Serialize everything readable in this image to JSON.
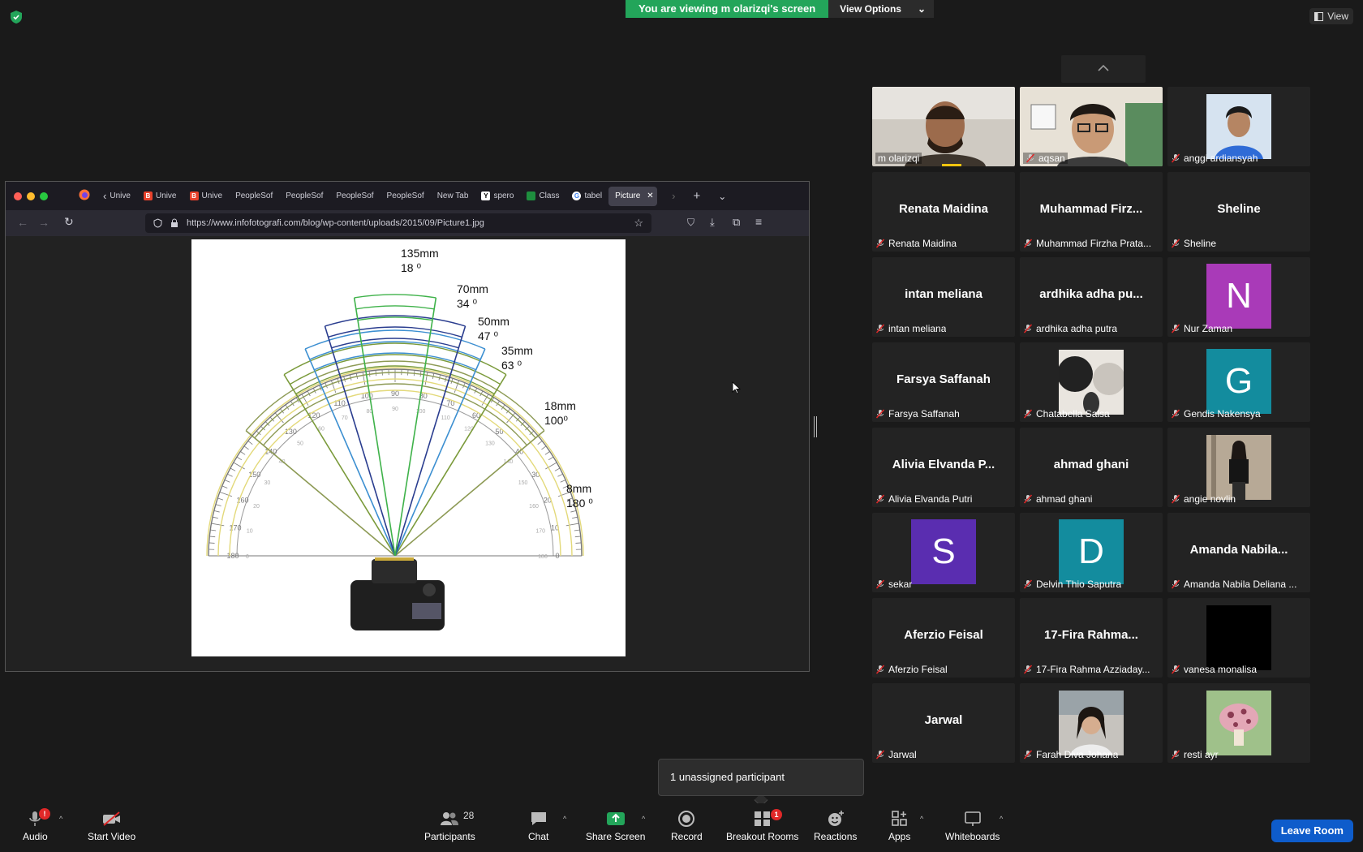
{
  "banner": {
    "viewing": "You are viewing m olarizqi's screen",
    "view_options": "View Options"
  },
  "view_button": "View",
  "browser": {
    "tabs": [
      "Unive",
      "Unive",
      "Unive",
      "PeopleSof",
      "PeopleSof",
      "PeopleSof",
      "PeopleSof",
      "New Tab",
      "spero",
      "Class",
      "tabel",
      "Picture"
    ],
    "url": "https://www.infofotografi.com/blog/wp-content/uploads/2015/09/Picture1.jpg"
  },
  "diagram": {
    "labels": [
      {
        "mm": "135mm",
        "deg": "18 ⁰"
      },
      {
        "mm": "70mm",
        "deg": "34 ⁰"
      },
      {
        "mm": "50mm",
        "deg": "47 ⁰"
      },
      {
        "mm": "35mm",
        "deg": "63 ⁰"
      },
      {
        "mm": "18mm",
        "deg": "100⁰"
      },
      {
        "mm": "8mm",
        "deg": "180 ⁰"
      }
    ],
    "colors": {
      "c135": "#3fb24a",
      "c70": "#2a3d8f",
      "c50": "#3c8fd1",
      "c35": "#7a9a3a",
      "c18": "#8d9a55",
      "c8": "#e3d97a"
    }
  },
  "participants": [
    {
      "name": "m olarizqi",
      "kind": "video",
      "photo": "man-glasses-off"
    },
    {
      "name": "aqsan",
      "kind": "video",
      "photo": "boy-glasses"
    },
    {
      "name": "anggi ardiansyah",
      "kind": "photo",
      "photo": "boy-blue"
    },
    {
      "name": "Renata Maidina",
      "kind": "text",
      "big": "Renata Maidina"
    },
    {
      "name": "Muhammad Firzha Prata...",
      "kind": "text",
      "big": "Muhammad  Firz..."
    },
    {
      "name": "Sheline",
      "kind": "text",
      "big": "Sheline"
    },
    {
      "name": "intan meliana",
      "kind": "text",
      "big": "intan meliana"
    },
    {
      "name": "ardhika adha putra",
      "kind": "text",
      "big": "ardhika  adha  pu..."
    },
    {
      "name": "Nur Zaman",
      "kind": "avatar",
      "letter": "N",
      "color": "#a93ab8"
    },
    {
      "name": "Farsya Saffanah",
      "kind": "text",
      "big": "Farsya Saffanah"
    },
    {
      "name": "Chatabella Salsa",
      "kind": "photo",
      "photo": "circles"
    },
    {
      "name": "Gendis Nakensya",
      "kind": "avatar",
      "letter": "G",
      "color": "#138c9e"
    },
    {
      "name": "Alivia Elvanda Putri",
      "kind": "text",
      "big": "Alivia  Elvanda  P..."
    },
    {
      "name": "ahmad ghani",
      "kind": "text",
      "big": "ahmad ghani"
    },
    {
      "name": "angie novlin",
      "kind": "photo",
      "photo": "mirror-selfie"
    },
    {
      "name": "sekar",
      "kind": "avatar",
      "letter": "S",
      "color": "#5a2db0"
    },
    {
      "name": "Delvin Thio Saputra",
      "kind": "avatar",
      "letter": "D",
      "color": "#138c9e"
    },
    {
      "name": "Amanda Nabila Deliana ...",
      "kind": "text",
      "big": "Amanda  Nabila..."
    },
    {
      "name": "Aferzio Feisal",
      "kind": "text",
      "big": "Aferzio Feisal"
    },
    {
      "name": "17-Fira Rahma Azziaday...",
      "kind": "text",
      "big": "17-Fira  Rahma..."
    },
    {
      "name": "vanesa monalisa",
      "kind": "photo",
      "photo": "black"
    },
    {
      "name": "Jarwal",
      "kind": "text",
      "big": "Jarwal"
    },
    {
      "name": "Farah Diva Johana",
      "kind": "photo",
      "photo": "girl-car"
    },
    {
      "name": "resti ayr",
      "kind": "photo",
      "photo": "mushroom"
    }
  ],
  "popup": "1 unassigned participant",
  "toolbar": {
    "audio": "Audio",
    "start_video": "Start Video",
    "participants": "Participants",
    "participant_count": "28",
    "chat": "Chat",
    "share_screen": "Share Screen",
    "record": "Record",
    "breakout_rooms": "Breakout Rooms",
    "breakout_badge": "1",
    "reactions": "Reactions",
    "apps": "Apps",
    "whiteboards": "Whiteboards",
    "audio_badge": "!",
    "leave": "Leave Room"
  }
}
